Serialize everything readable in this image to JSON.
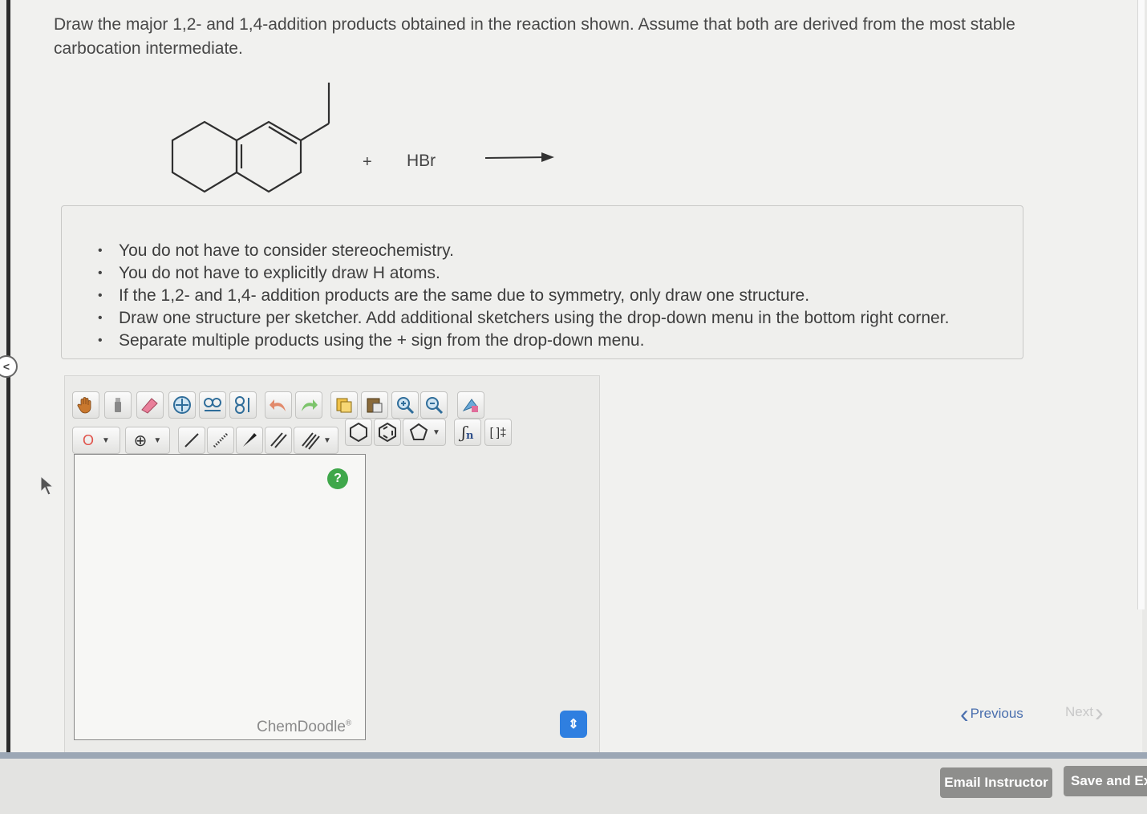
{
  "question": {
    "line1": "Draw the major 1,2- and 1,4-addition products obtained in the reaction shown. Assume that both are derived from the most stable",
    "line2": "carbocation intermediate."
  },
  "reaction": {
    "plus": "+",
    "reagent": "HBr"
  },
  "instructions": [
    "You do not have to consider stereochemistry.",
    "You do not have to explicitly draw H atoms.",
    "If the 1,2- and 1,4- addition products are the same due to symmetry, only draw one structure.",
    "Draw one structure per sketcher. Add additional sketchers using the drop-down menu in the bottom right corner.",
    "Separate multiple products using the + sign from the drop-down menu."
  ],
  "toolbar": {
    "atom_label": "O",
    "charge_label": "⊕",
    "polymer_label": "n",
    "brackets_label": "[ ]‡"
  },
  "sketcher": {
    "help": "?",
    "brand": "ChemDoodle",
    "brand_mark": "®"
  },
  "nav": {
    "previous": "Previous",
    "next": "Next"
  },
  "footer": {
    "email_button": "Email Instructor",
    "save_button": "Save and Exit"
  },
  "colors": {
    "help_badge": "#3fa74a",
    "spinner": "#2f7fe0",
    "link": "#4a6fae"
  }
}
